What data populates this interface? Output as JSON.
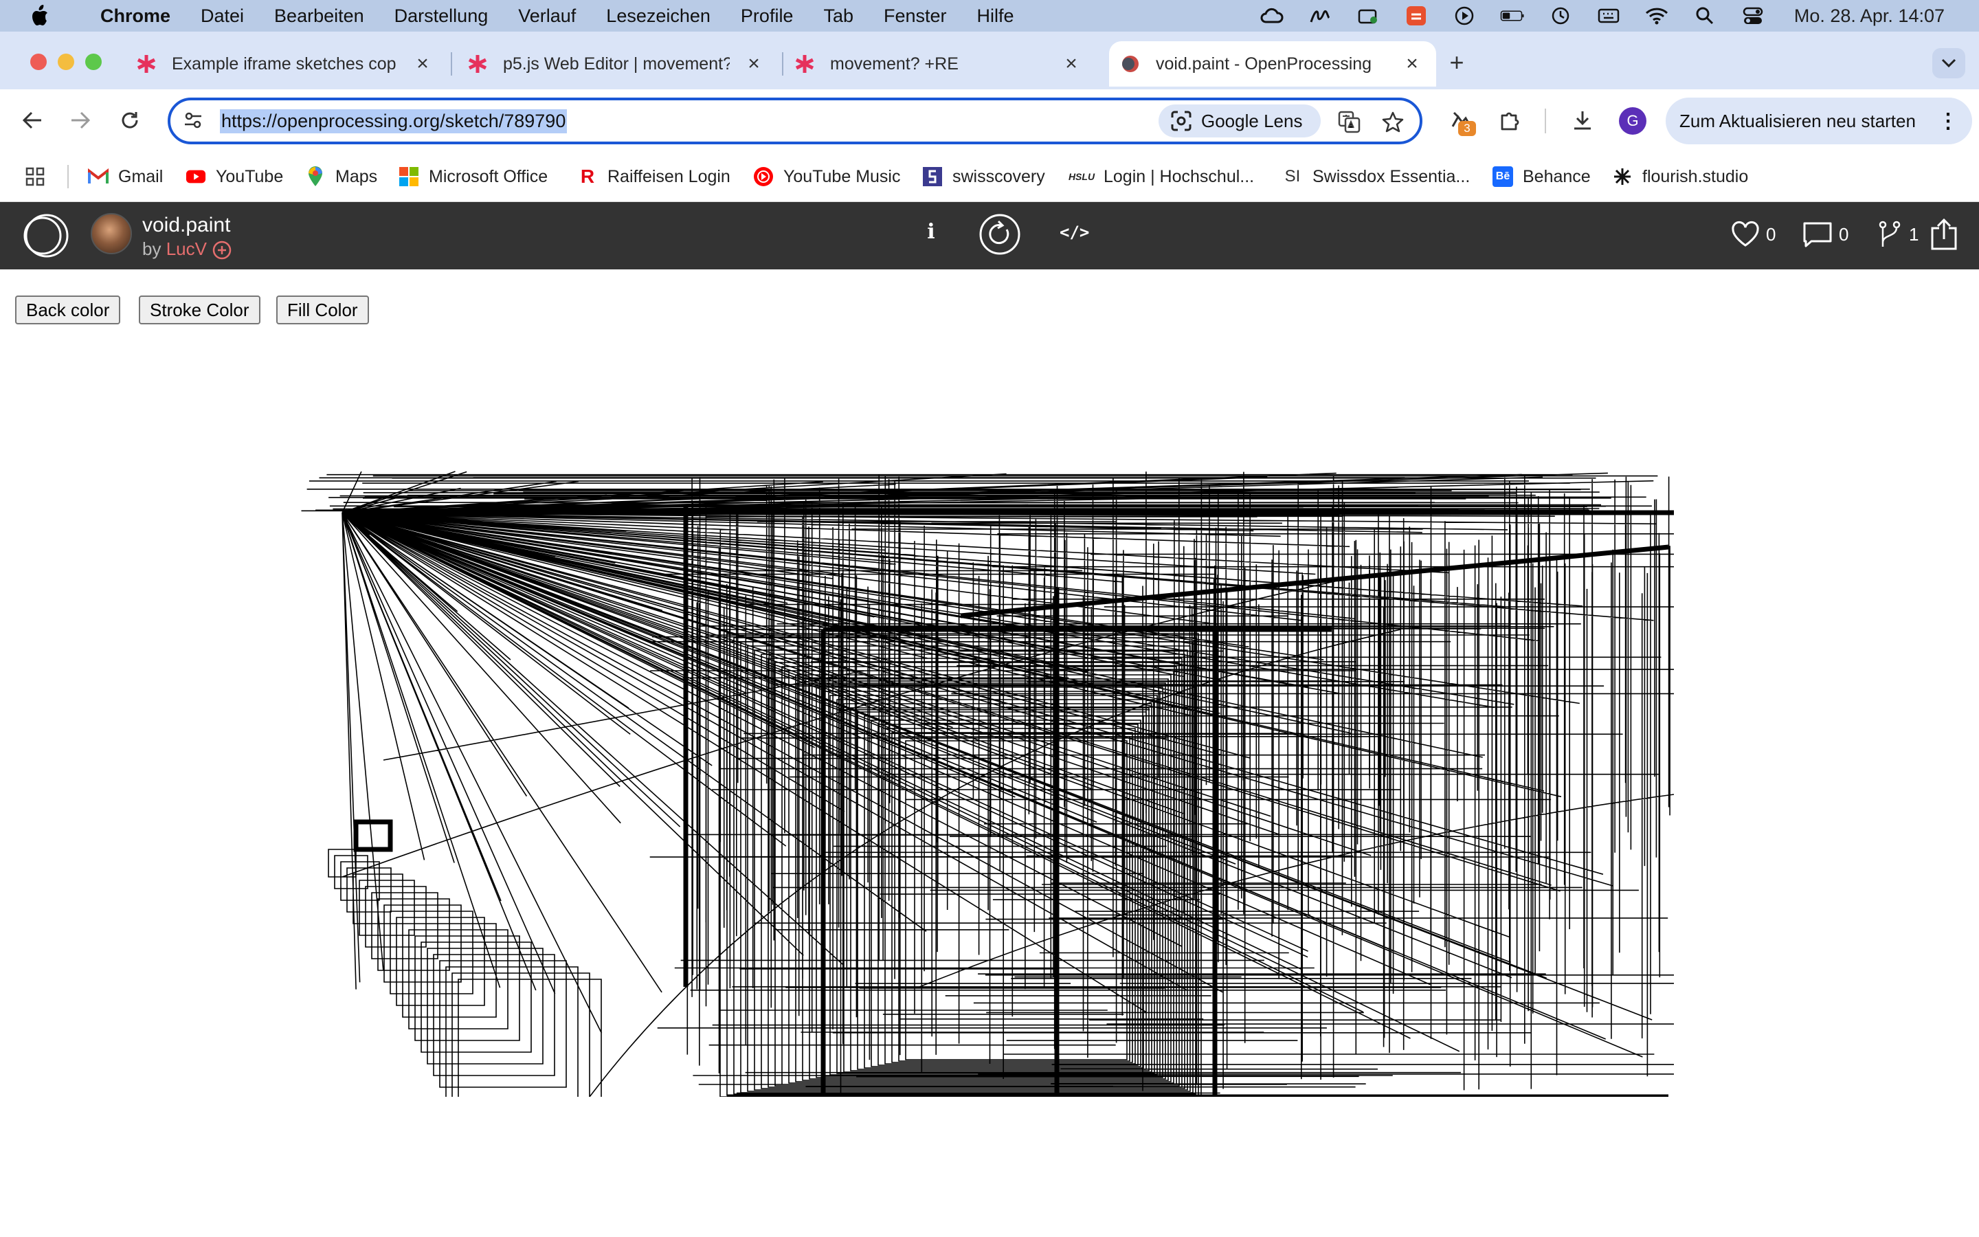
{
  "menubar": {
    "app": "Chrome",
    "items": [
      "Datei",
      "Bearbeiten",
      "Darstellung",
      "Verlauf",
      "Lesezeichen",
      "Profile",
      "Tab",
      "Fenster",
      "Hilfe"
    ],
    "clock": "Mo. 28. Apr.  14:07"
  },
  "tabs": [
    {
      "title": "Example iframe sketches cop",
      "favicon": "p5-asterisk-icon"
    },
    {
      "title": "p5.js Web Editor | movement?",
      "favicon": "p5-asterisk-icon"
    },
    {
      "title": "movement? +RE",
      "favicon": "p5-asterisk-icon"
    },
    {
      "title": "void.paint - OpenProcessing",
      "favicon": "openprocessing-icon",
      "active": true
    }
  ],
  "toolbar": {
    "url": "https://openprocessing.org/sketch/789790",
    "lens_label": "Google Lens",
    "extension_badge": "3",
    "profile_initial": "G",
    "update_label": "Zum Aktualisieren neu starten"
  },
  "bookmarks": [
    {
      "label": "Gmail",
      "icon": "gmail-icon"
    },
    {
      "label": "YouTube",
      "icon": "youtube-icon"
    },
    {
      "label": "Maps",
      "icon": "maps-icon"
    },
    {
      "label": "Microsoft Office",
      "icon": "microsoft-office-icon"
    },
    {
      "label": "Raiffeisen Login",
      "icon": "raiffeisen-icon"
    },
    {
      "label": "YouTube Music",
      "icon": "youtube-music-icon"
    },
    {
      "label": "swisscovery",
      "icon": "swisscovery-icon"
    },
    {
      "label": "Login | Hochschul...",
      "icon": "hslu-icon",
      "icon_text": "HSLU"
    },
    {
      "label": "Swissdox Essentia...",
      "icon": "swissdox-icon",
      "icon_text": "SI"
    },
    {
      "label": "Behance",
      "icon": "behance-icon",
      "icon_text": "Bē"
    },
    {
      "label": "flourish.studio",
      "icon": "flourish-icon"
    }
  ],
  "sketch": {
    "title": "void.paint",
    "by_prefix": "by ",
    "author": "LucV",
    "info_label": "i",
    "code_label": "</>",
    "likes": "0",
    "comments": "0",
    "forks": "1"
  },
  "buttons": {
    "back_color": "Back color",
    "stroke_color": "Stroke Color",
    "fill_color": "Fill Color"
  },
  "colors": {
    "menubar_bg": "#b9cbe6",
    "tabstrip_bg": "#dae4f7",
    "omnibox_focus": "#1a57d6",
    "op_header_bg": "#333333",
    "author_accent": "#e66e6e"
  }
}
